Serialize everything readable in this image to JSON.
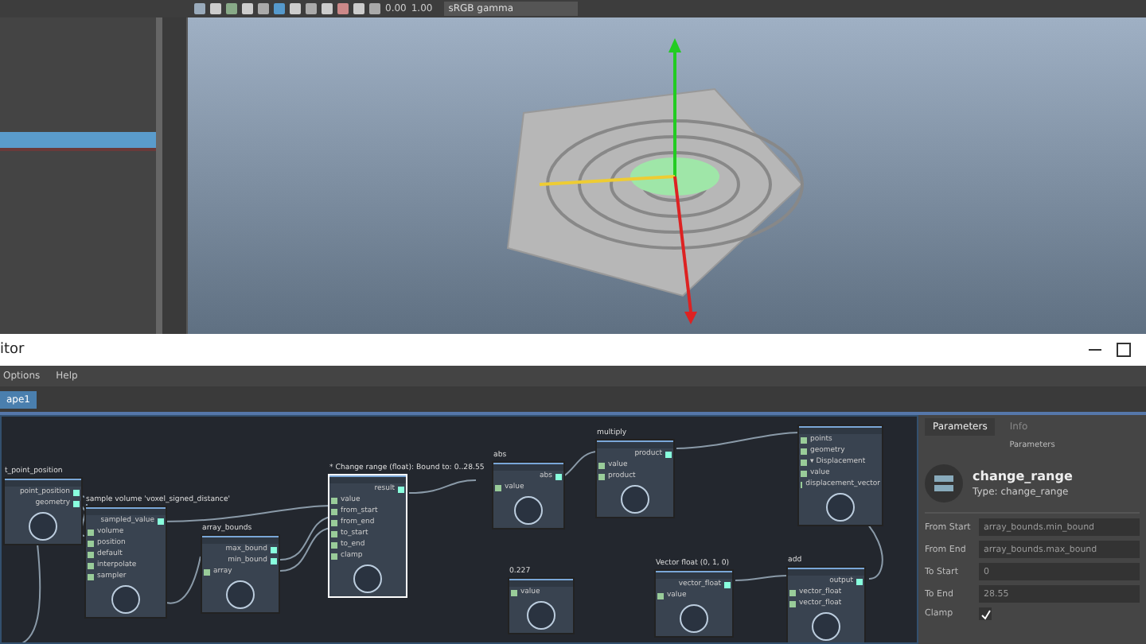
{
  "toolbar": {
    "readouts": [
      "0.00",
      "1.00"
    ],
    "color_space": "sRGB gamma"
  },
  "editor": {
    "title": "itor",
    "menu": [
      "Options",
      "Help"
    ],
    "tabs": [
      {
        "label": "ape1",
        "selected": true
      }
    ]
  },
  "graph": {
    "nodes": [
      {
        "title": "t_point_position",
        "selected": false,
        "outputs": [
          "point_position",
          "geometry"
        ]
      },
      {
        "title": "sample volume 'voxel_signed_distance'",
        "selected": false,
        "inputs": [
          "volume",
          "position",
          "default",
          "interpolate",
          "sampler"
        ],
        "outputs": [
          "sampled_value"
        ]
      },
      {
        "title": "array_bounds",
        "selected": false,
        "inputs": [
          "array"
        ],
        "outputs": [
          "max_bound",
          "min_bound"
        ]
      },
      {
        "title": "* Change range (float): Bound to: 0..28.55",
        "selected": true,
        "inputs": [
          "value",
          "from_start",
          "from_end",
          "to_start",
          "to_end",
          "clamp"
        ],
        "outputs": [
          "result"
        ]
      },
      {
        "title": "abs",
        "selected": false,
        "inputs": [
          "value"
        ],
        "outputs": [
          "abs"
        ]
      },
      {
        "title": "multiply",
        "selected": false,
        "inputs": [
          "value",
          "product"
        ],
        "outputs": [
          "product"
        ]
      },
      {
        "selected": false,
        "inputs": [
          "points",
          "geometry",
          "▾ Displacement",
          "value",
          "displacement_vector"
        ]
      },
      {
        "title": "0.227",
        "selected": false,
        "inputs": [
          "value"
        ]
      },
      {
        "title": "Vector float (0, 1, 0)",
        "selected": false,
        "inputs": [
          "value"
        ],
        "outputs": [
          "vector_float"
        ]
      },
      {
        "title": "add",
        "selected": false,
        "inputs": [
          "vector_float",
          "vector_float"
        ],
        "outputs": [
          "output"
        ]
      }
    ]
  },
  "parameters": {
    "tabs": [
      {
        "label": "Parameters",
        "selected": true
      },
      {
        "label": "Info",
        "selected": false
      }
    ],
    "heading": "Parameters",
    "node_name": "change_range",
    "node_type": "Type: change_range",
    "fields": [
      {
        "label": "From Start",
        "value": "array_bounds.min_bound"
      },
      {
        "label": "From End",
        "value": "array_bounds.max_bound"
      },
      {
        "label": "To Start",
        "value": "0"
      },
      {
        "label": "To End",
        "value": "28.55"
      }
    ],
    "clamp": {
      "label": "Clamp",
      "checked": true
    }
  }
}
